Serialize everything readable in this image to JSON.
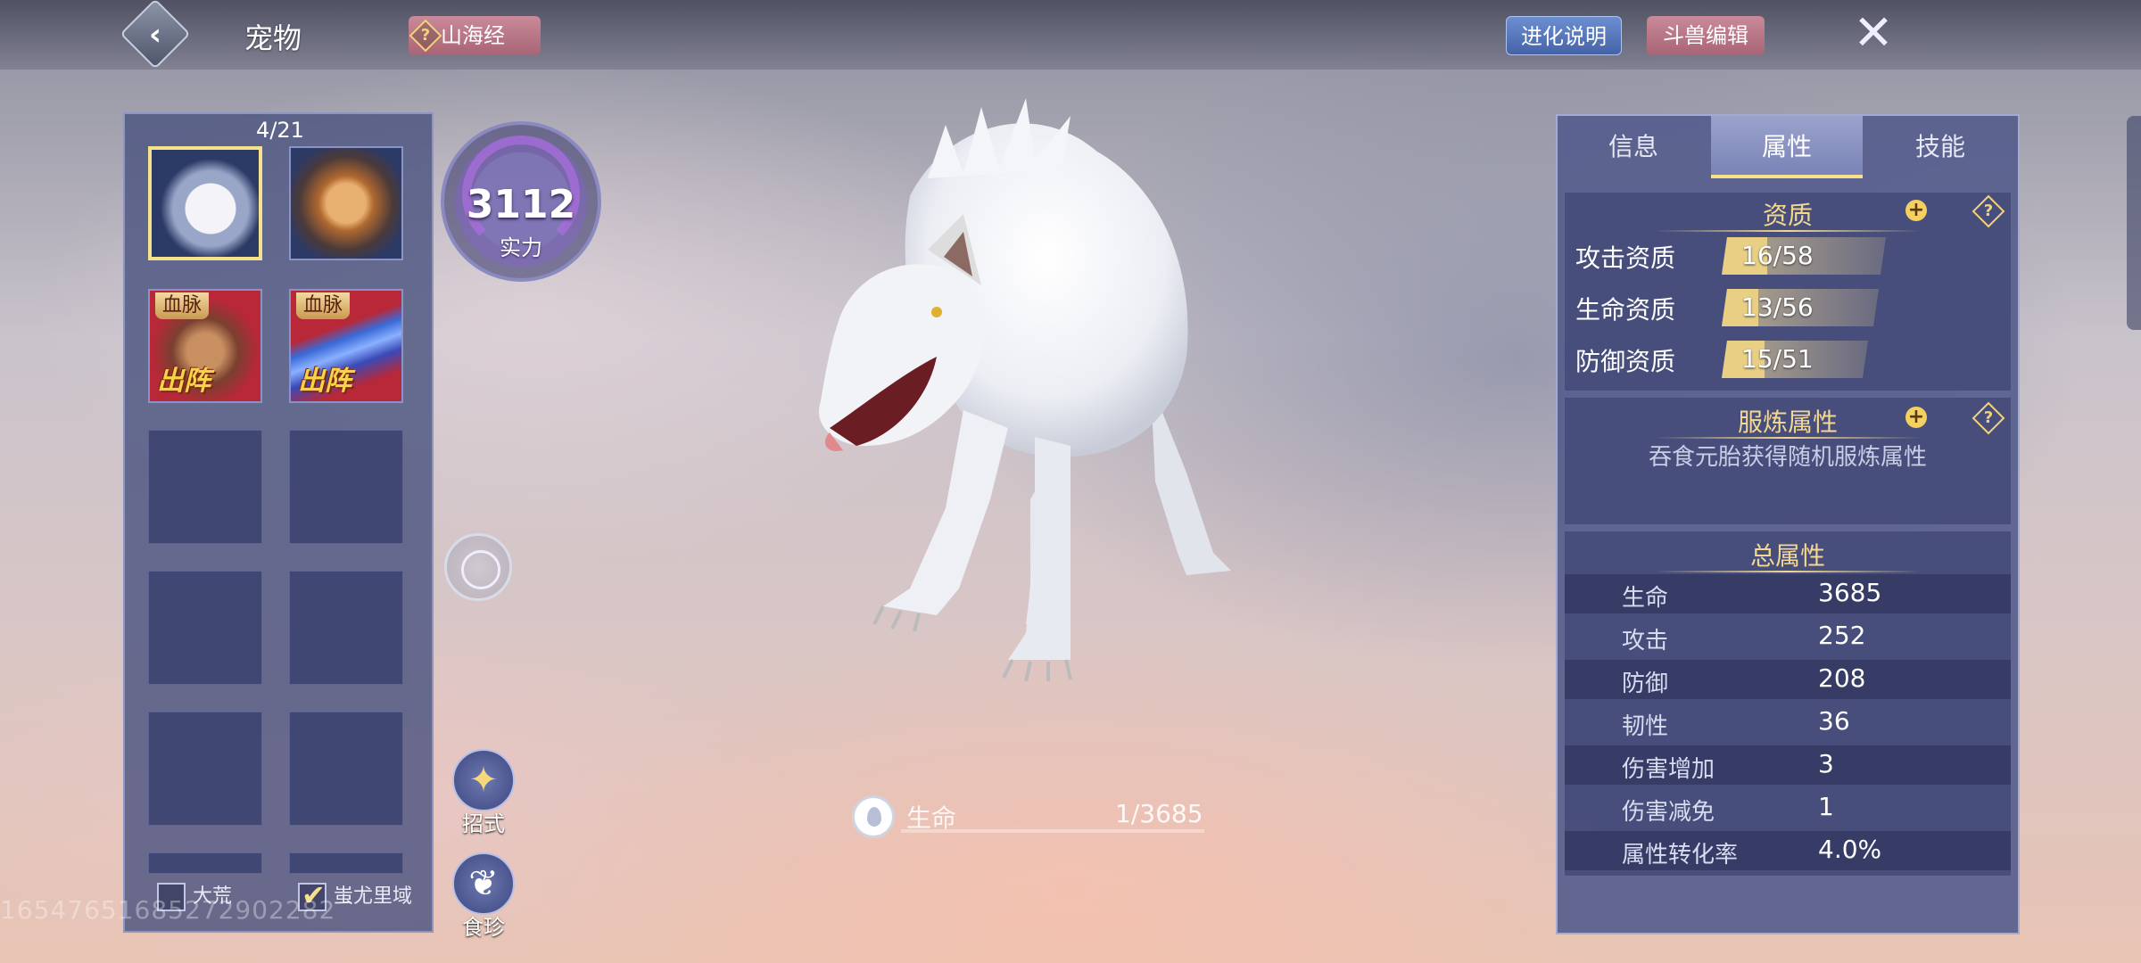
{
  "header": {
    "title": "宠物",
    "shanhai_label": "山海经",
    "evolve_label": "进化说明",
    "edit_label": "斗兽编辑"
  },
  "pet_list": {
    "count": "4/21",
    "slots": [
      {
        "name": "wolf",
        "selected": true
      },
      {
        "name": "lion"
      },
      {
        "name": "bloodline-beast-1",
        "tag": "血脉",
        "deploy": "出阵"
      },
      {
        "name": "bloodline-beast-2",
        "tag": "血脉",
        "deploy": "出阵"
      }
    ],
    "filters": [
      {
        "label": "大荒",
        "checked": false
      },
      {
        "label": "蚩尤里域",
        "checked": true
      }
    ],
    "watermark": "16547651685272902282"
  },
  "power": {
    "value": "3112",
    "label": "实力"
  },
  "side_buttons": {
    "moves_label": "招式",
    "food_label": "食珍"
  },
  "hp": {
    "label": "生命",
    "value": "1/3685"
  },
  "info_panel": {
    "tabs": [
      "信息",
      "属性",
      "技能"
    ],
    "active_tab": "属性",
    "aptitude": {
      "title": "资质",
      "rows": [
        {
          "label": "攻击资质",
          "value": "16/58",
          "fraction": 0.276
        },
        {
          "label": "生命资质",
          "value": "13/56",
          "fraction": 0.232
        },
        {
          "label": "防御资质",
          "value": "15/51",
          "fraction": 0.294
        }
      ]
    },
    "refine": {
      "title": "服炼属性",
      "desc": "吞食元胎获得随机服炼属性"
    },
    "total": {
      "title": "总属性",
      "rows": [
        {
          "name": "生命",
          "value": "3685"
        },
        {
          "name": "攻击",
          "value": "252"
        },
        {
          "name": "防御",
          "value": "208"
        },
        {
          "name": "韧性",
          "value": "36"
        },
        {
          "name": "伤害增加",
          "value": "3"
        },
        {
          "name": "伤害减免",
          "value": "1"
        },
        {
          "name": "属性转化率",
          "value": "4.0%"
        }
      ]
    }
  },
  "colors": {
    "accent_gold": "#f3d890",
    "selected_border": "#f6e28a",
    "panel": "#545c8c"
  }
}
